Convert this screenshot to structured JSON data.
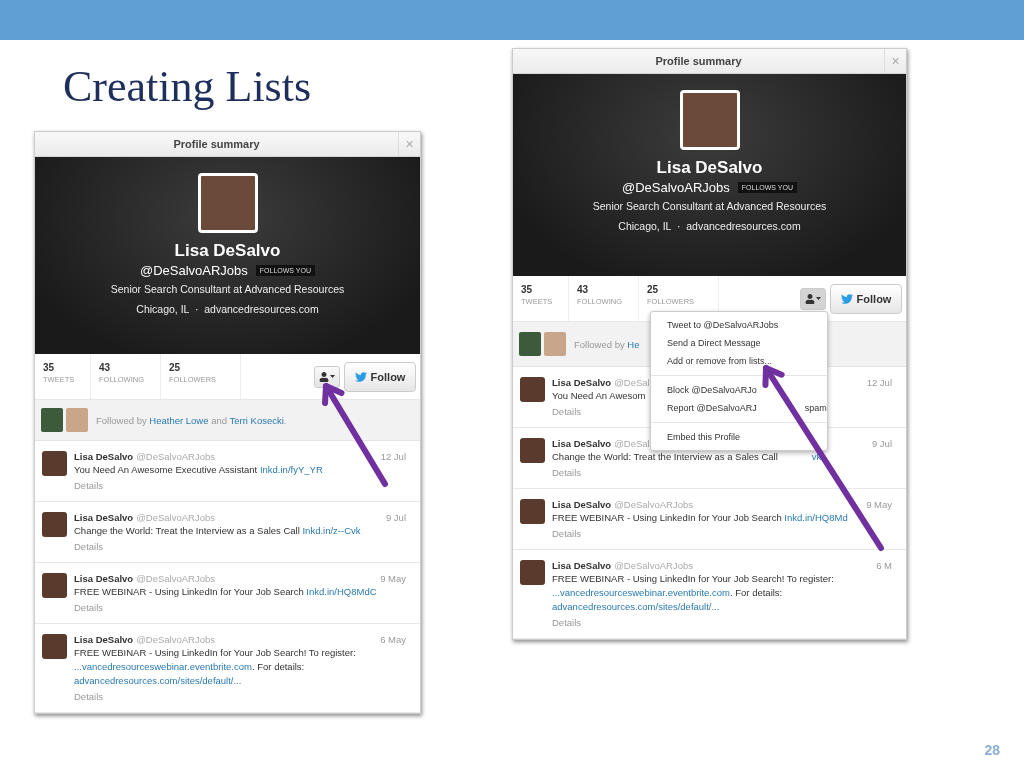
{
  "slide": {
    "title": "Creating Lists",
    "page_number": "28"
  },
  "cards": [
    {
      "header": "Profile summary",
      "close": "×",
      "name": "Lisa DeSalvo",
      "handle": "@DeSalvoARJobs",
      "badge": "FOLLOWS YOU",
      "bio": "Senior Search Consultant at Advanced Resources",
      "location": "Chicago, IL  ·  advancedresources.com",
      "stats": [
        {
          "value": "35",
          "label": "TWEETS"
        },
        {
          "value": "43",
          "label": "FOLLOWING"
        },
        {
          "value": "25",
          "label": "FOLLOWERS"
        }
      ],
      "follow": "Follow",
      "followed_by": [
        {
          "text": "Followed by ",
          "kind": "plain"
        },
        {
          "text": "Heather Lowe",
          "kind": "link"
        },
        {
          "text": " and ",
          "kind": "plain"
        },
        {
          "text": "Terri Kosecki",
          "kind": "link"
        },
        {
          "text": ".",
          "kind": "plain"
        }
      ],
      "tweets": [
        {
          "name": "Lisa DeSalvo",
          "handle": "@DeSalvoARJobs",
          "date": "12 Jul",
          "details": "Details",
          "text": [
            {
              "text": "You Need An Awesome Executive Assistant ",
              "kind": "plain"
            },
            {
              "text": "Inkd.in/fyY_YR",
              "kind": "link"
            }
          ]
        },
        {
          "name": "Lisa DeSalvo",
          "handle": "@DeSalvoARJobs",
          "date": "9 Jul",
          "details": "Details",
          "text": [
            {
              "text": "Change the World: Treat the Interview as a Sales Call ",
              "kind": "plain"
            },
            {
              "text": "Inkd.in/z--Cvk",
              "kind": "link"
            }
          ]
        },
        {
          "name": "Lisa DeSalvo",
          "handle": "@DeSalvoARJobs",
          "date": "9 May",
          "details": "Details",
          "text": [
            {
              "text": "FREE WEBINAR - Using LinkedIn for Your Job Search ",
              "kind": "plain"
            },
            {
              "text": "Inkd.in/HQ8MdC",
              "kind": "link"
            }
          ]
        },
        {
          "name": "Lisa DeSalvo",
          "handle": "@DeSalvoARJobs",
          "date": "6 May",
          "details": "Details",
          "text": [
            {
              "text": "FREE WEBINAR - Using LinkedIn for Your Job Search!   To register: ",
              "kind": "plain"
            },
            {
              "text": "...vancedresourceswebinar.eventbrite.com",
              "kind": "link"
            },
            {
              "text": ". For details: ",
              "kind": "plain"
            },
            {
              "text": "advancedresources.com/sites/default/...",
              "kind": "link"
            }
          ]
        }
      ]
    },
    {
      "header": "Profile summary",
      "close": "×",
      "name": "Lisa DeSalvo",
      "handle": "@DeSalvoARJobs",
      "badge": "FOLLOWS YOU",
      "bio": "Senior Search Consultant at Advanced Resources",
      "location": "Chicago, IL  ·  advancedresources.com",
      "stats": [
        {
          "value": "35",
          "label": "TWEETS"
        },
        {
          "value": "43",
          "label": "FOLLOWING"
        },
        {
          "value": "25",
          "label": "FOLLOWERS"
        }
      ],
      "follow": "Follow",
      "followed_by": [
        {
          "text": "Followed by ",
          "kind": "plain"
        },
        {
          "text": "He",
          "kind": "link"
        }
      ],
      "menu": [
        {
          "kind": "item",
          "label": "Tweet to @DeSalvoARJobs"
        },
        {
          "kind": "item",
          "label": "Send a Direct Message"
        },
        {
          "kind": "item",
          "label": "Add or remove from lists..."
        },
        {
          "kind": "divider"
        },
        {
          "kind": "item",
          "label": "Block @DeSalvoARJo"
        },
        {
          "kind": "item",
          "label": "Report @DeSalvoARJ",
          "tail": "spam"
        },
        {
          "kind": "divider"
        },
        {
          "kind": "item",
          "label": "Embed this Profile"
        }
      ],
      "tweets": [
        {
          "name": "Lisa DeSalvo",
          "handle": "@DeSal",
          "date": "12 Jul",
          "details": "Details",
          "text": [
            {
              "text": "You Need An Awesom",
              "kind": "plain"
            }
          ]
        },
        {
          "name": "Lisa DeSalvo",
          "handle": "@DeSal",
          "date": "9 Jul",
          "details": "Details",
          "text": [
            {
              "text": "Change the World: Treat the Interview as a Sales Call",
              "kind": "plain"
            },
            {
              "text": "vk",
              "kind": "link",
              "gap_before": true
            }
          ]
        },
        {
          "name": "Lisa DeSalvo",
          "handle": "@DeSalvoARJobs",
          "date": "9 May",
          "details": "Details",
          "text": [
            {
              "text": "FREE WEBINAR - Using LinkedIn for Your Job Search ",
              "kind": "plain"
            },
            {
              "text": "Inkd.in/HQ8Md",
              "kind": "link"
            }
          ]
        },
        {
          "name": "Lisa DeSalvo",
          "handle": "@DeSalvoARJobs",
          "date": "6 M",
          "details": "Details",
          "text": [
            {
              "text": "FREE WEBINAR - Using LinkedIn for Your Job Search!   To register: ",
              "kind": "plain"
            },
            {
              "text": "...vancedresourceswebinar.eventbrite.com",
              "kind": "link"
            },
            {
              "text": ". For details: ",
              "kind": "plain"
            },
            {
              "text": "advancedresources.com/sites/default/...",
              "kind": "link"
            }
          ]
        }
      ]
    }
  ]
}
